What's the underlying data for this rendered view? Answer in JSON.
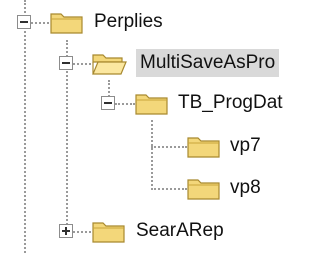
{
  "tree": {
    "nodes": [
      {
        "label": "Perplies",
        "expander": "minus",
        "selected": false,
        "icon": "folder-icon"
      },
      {
        "label": "MultiSaveAsPro",
        "expander": "minus",
        "selected": true,
        "icon": "folder-open-icon"
      },
      {
        "label": "TB_ProgDat",
        "expander": "minus",
        "selected": false,
        "icon": "folder-icon"
      },
      {
        "label": "vp7",
        "expander": "none",
        "selected": false,
        "icon": "folder-icon"
      },
      {
        "label": "vp8",
        "expander": "none",
        "selected": false,
        "icon": "folder-icon"
      },
      {
        "label": "SearARep",
        "expander": "plus",
        "selected": false,
        "icon": "folder-icon"
      }
    ]
  },
  "colors": {
    "folder_fill": "#f3d77a",
    "folder_dark": "#c9a43a",
    "selection": "#d9d9d9"
  }
}
